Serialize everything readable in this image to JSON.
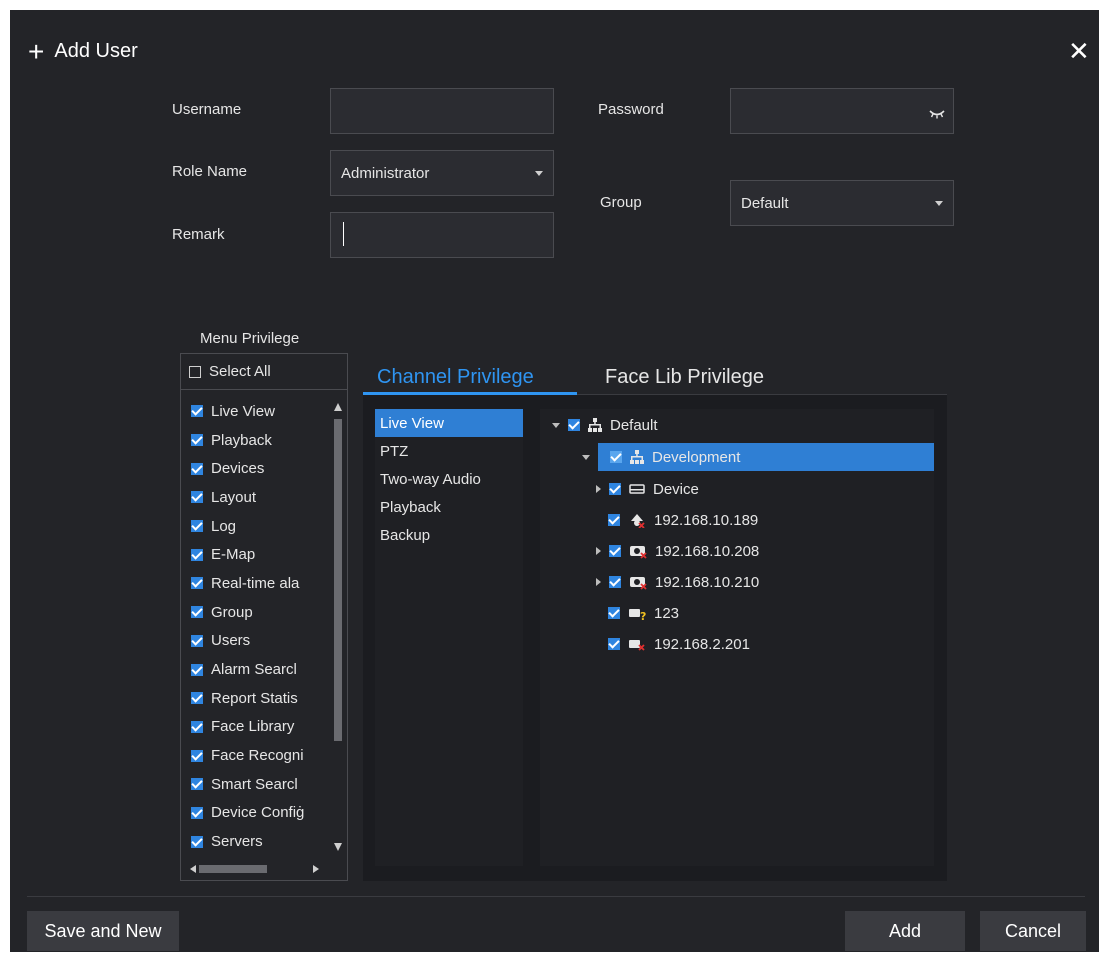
{
  "dialog": {
    "title": "Add User",
    "close_icon": "close-icon",
    "plus_icon": "plus-icon"
  },
  "form": {
    "username_label": "Username",
    "username_value": "",
    "password_label": "Password",
    "password_value": "",
    "role_label": "Role Name",
    "role_value": "Administrator",
    "group_label": "Group",
    "group_value": "Default",
    "remark_label": "Remark",
    "remark_value": ""
  },
  "menu_privilege": {
    "legend": "Menu Privilege",
    "select_all": "Select All",
    "items": [
      "Live View",
      "Playback",
      "Devices",
      "Layout",
      "Log",
      "E-Map",
      "Real-time ala",
      "Group",
      "Users",
      "Alarm Searcl",
      "Report Statis",
      "Face Library",
      "Face Recogni",
      "Smart Searcl",
      "Device Confiġ",
      "Servers"
    ]
  },
  "tabs": [
    "Channel Privilege",
    "Face Lib Privilege"
  ],
  "channel_types": [
    "Live View",
    "PTZ",
    "Two-way Audio",
    "Playback",
    "Backup"
  ],
  "tree": {
    "root": "Default",
    "group": "Development",
    "device_group": "Device",
    "devices": [
      "192.168.10.189",
      "192.168.10.208",
      "192.168.10.210",
      "123",
      "192.168.2.201"
    ]
  },
  "buttons": {
    "save_new": "Save and New",
    "add": "Add",
    "cancel": "Cancel"
  },
  "colors": {
    "accent": "#2f95f2",
    "selection": "#2f7fd4",
    "background": "#232428"
  }
}
